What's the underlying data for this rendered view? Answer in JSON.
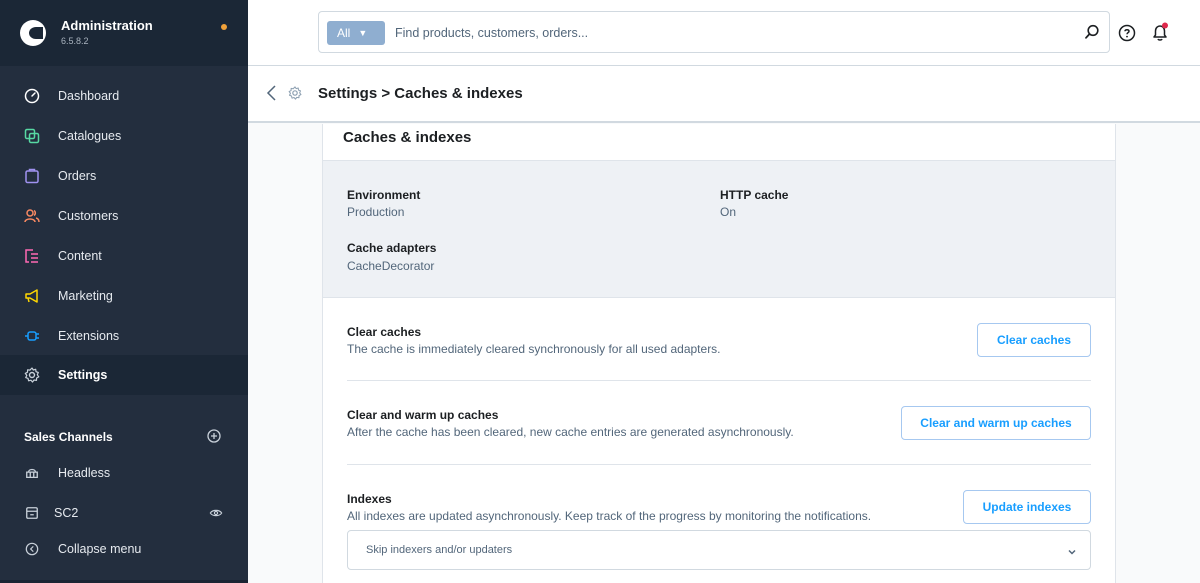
{
  "sidebar": {
    "brand": {
      "title": "Administration",
      "version": "6.5.8.2"
    },
    "nav": [
      {
        "label": "Dashboard",
        "icon": "dashboard-icon",
        "color": "#ffffff"
      },
      {
        "label": "Catalogues",
        "icon": "catalogues-icon",
        "color": "#57d9a3"
      },
      {
        "label": "Orders",
        "icon": "orders-icon",
        "color": "#a092f0"
      },
      {
        "label": "Customers",
        "icon": "customers-icon",
        "color": "#f88962"
      },
      {
        "label": "Content",
        "icon": "content-icon",
        "color": "#ff68b4"
      },
      {
        "label": "Marketing",
        "icon": "marketing-icon",
        "color": "#ffd700"
      },
      {
        "label": "Extensions",
        "icon": "extensions-icon",
        "color": "#189eff"
      },
      {
        "label": "Settings",
        "icon": "settings-icon",
        "color": "#9aa8b5"
      }
    ],
    "sales_channels": {
      "heading": "Sales Channels",
      "items": [
        {
          "label": "Headless",
          "icon": "headless-icon"
        },
        {
          "label": "SC2",
          "icon": "storefront-icon"
        }
      ]
    },
    "collapse_label": "Collapse menu"
  },
  "topbar": {
    "search_type": "All",
    "search_placeholder": "Find products, customers, orders..."
  },
  "header": {
    "title": "Settings > Caches & indexes"
  },
  "card": {
    "title": "Caches & indexes",
    "info": {
      "environment_label": "Environment",
      "environment_value": "Production",
      "http_cache_label": "HTTP cache",
      "http_cache_value": "On",
      "cache_adapters_label": "Cache adapters",
      "cache_adapters_value": "CacheDecorator"
    },
    "clear_caches": {
      "title": "Clear caches",
      "description": "The cache is immediately cleared synchronously for all used adapters.",
      "button": "Clear caches"
    },
    "warm_up": {
      "title": "Clear and warm up caches",
      "description": "After the cache has been cleared, new cache entries are generated asynchronously.",
      "button": "Clear and warm up caches"
    },
    "indexes": {
      "title": "Indexes",
      "description": "All indexes are updated asynchronously. Keep track of the progress by monitoring the notifications.",
      "button": "Update indexes",
      "select_placeholder": "Skip indexers and/or updaters"
    }
  },
  "colors": {
    "sidebar_bg": "#232e3e",
    "accent": "#189eff",
    "notification": "#de294c",
    "brand_dot": "#f0a13a"
  }
}
